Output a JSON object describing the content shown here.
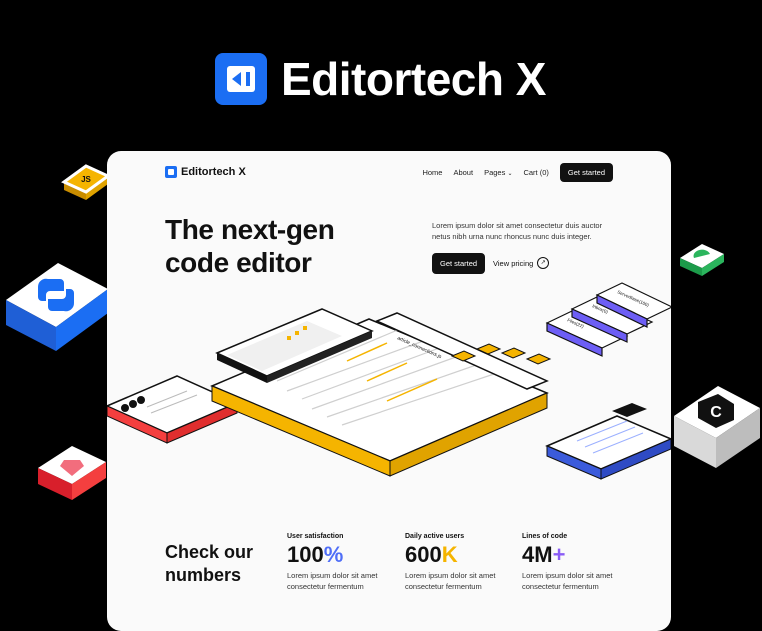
{
  "brand": {
    "name": "Editortech X"
  },
  "nav": {
    "brand": "Editortech X",
    "links": [
      "Home",
      "About",
      "Pages",
      "Cart (0)"
    ],
    "cta": "Get started"
  },
  "hero": {
    "title_line1": "The next-gen",
    "title_line2": "code editor",
    "description": "Lorem ipsum dolor sit amet consectetur duis auctor netus nibh urna nunc rhoncus nunc duis integer.",
    "primary_button": "Get started",
    "secondary_link": "View pricing"
  },
  "editor_illustration": {
    "file_tab": "article_connections.js",
    "stacked_cards": [
      "ServerBase(100)",
      "Inbox(0)",
      "Files(22)"
    ]
  },
  "stats": {
    "title_line1": "Check our",
    "title_line2": "numbers",
    "items": [
      {
        "label": "User satisfaction",
        "value": "100",
        "accent": "%",
        "accent_color": "#4f6ef7",
        "description": "Lorem ipsum dolor sit amet consectetur fermentum"
      },
      {
        "label": "Daily active users",
        "value": "600",
        "accent": "K",
        "accent_color": "#f5b400",
        "description": "Lorem ipsum dolor sit amet consectetur fermentum"
      },
      {
        "label": "Lines of code",
        "value": "4M",
        "accent": "+",
        "accent_color": "#8a5cf6",
        "description": "Lorem ipsum dolor sit amet consectetur fermentum"
      }
    ]
  },
  "badges": {
    "js": "JS"
  },
  "colors": {
    "brand_blue": "#1b6ef3",
    "frame_yellow": "#f5b400",
    "frame_red": "#f43f3f",
    "frame_purple": "#6d5ef5",
    "frame_blue": "#3b5bdb"
  }
}
